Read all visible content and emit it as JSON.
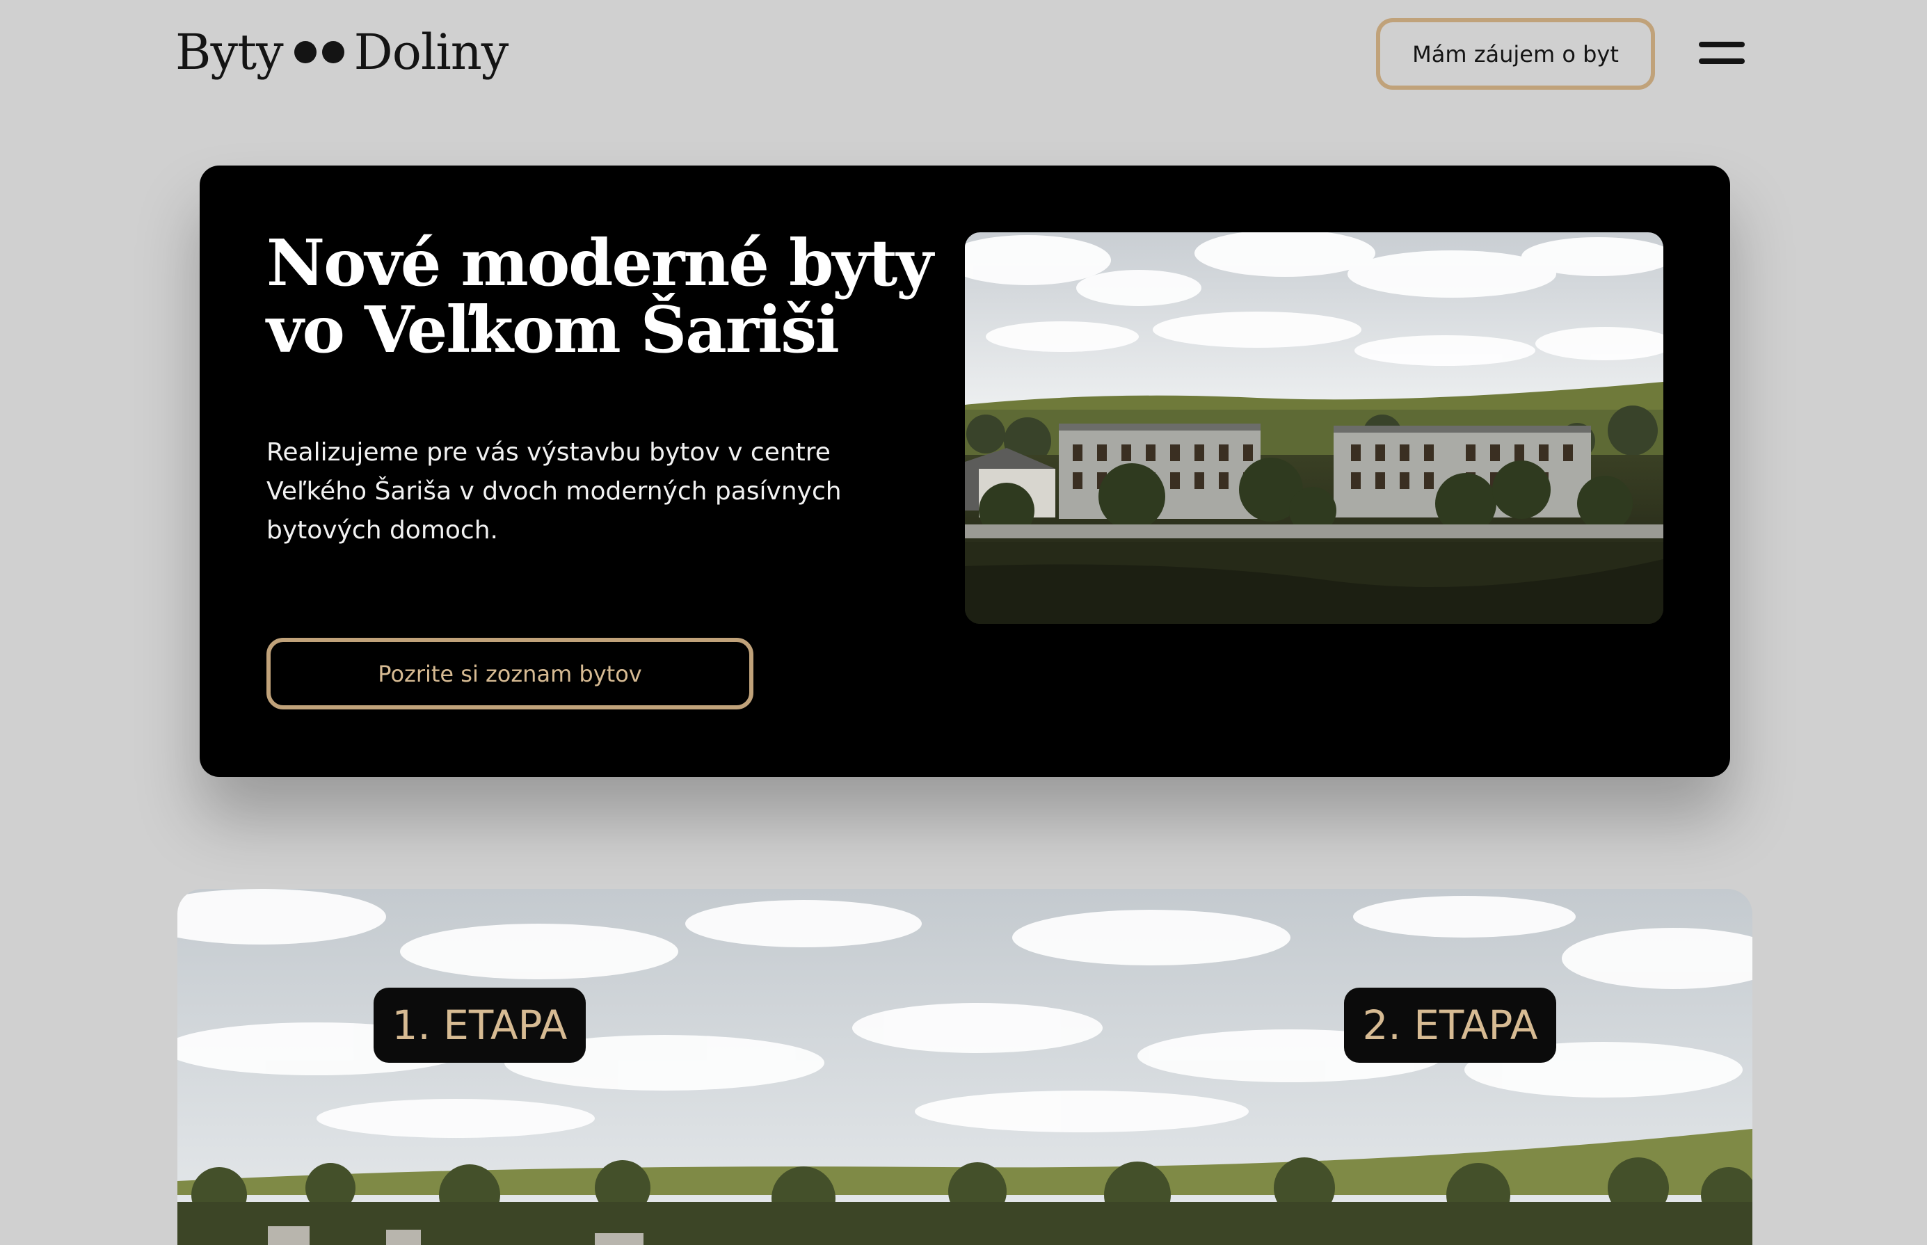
{
  "header": {
    "logo": {
      "left": "Byty",
      "right": "Doliny"
    },
    "interest_button": "Mám záujem o byt",
    "menu_icon": "hamburger-menu-icon"
  },
  "hero": {
    "title_lines": [
      "Nové moderné byty",
      "vo Veľkom Šariši"
    ],
    "description_lines": [
      "Realizujeme pre vás výstavbu bytov v centre",
      "Veľkého Šariša v dvoch moderných pasívnych",
      "bytových domoch."
    ],
    "list_button": "Pozrite si zoznam bytov"
  },
  "stages": {
    "stage1": "1. ETAPA",
    "stage2": "2. ETAPA"
  },
  "colors": {
    "background": "#d0d0d0",
    "accent_gold": "#c0a27a",
    "hero_bg": "#000000",
    "text_dark": "#141414"
  }
}
